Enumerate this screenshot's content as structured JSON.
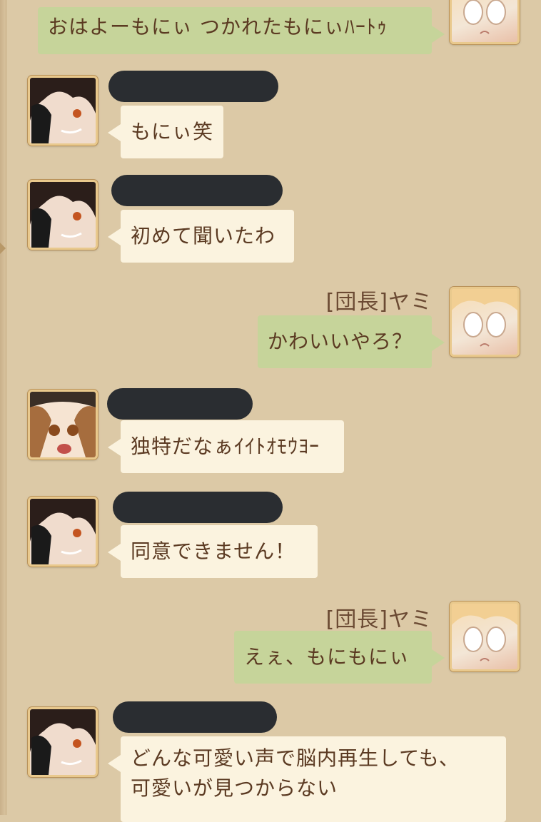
{
  "messages": [
    {
      "side": "right",
      "sender": "",
      "text": "おはよーもにぃ つかれたもにぃﾊｰﾄｩ"
    },
    {
      "side": "left",
      "sender_redacted": true,
      "text": "もにぃ笑"
    },
    {
      "side": "left",
      "sender_redacted": true,
      "text": "初めて聞いたわ"
    },
    {
      "side": "right",
      "sender": "[団長]ヤミ",
      "text": "かわいいやろ？"
    },
    {
      "side": "left",
      "sender_redacted": true,
      "text": "独特だなぁｲｲﾄｵﾓｳﾖｰ"
    },
    {
      "side": "left",
      "sender_redacted": true,
      "text": "同意できません！"
    },
    {
      "side": "right",
      "sender": "[団長]ヤミ",
      "text": "えぇ、もにもにぃ"
    },
    {
      "side": "left",
      "sender_redacted": true,
      "text": "どんな可愛い声で脳内再生しても、\n可愛いが見つからない",
      "lines": [
        "どんな可愛い声で脳内再生しても、",
        "可愛いが見つからない"
      ]
    }
  ],
  "colors": {
    "background": "#dcc9a6",
    "bubble_left": "#fbf3df",
    "bubble_right": "#c6d49a",
    "text": "#5b3a22",
    "redaction": "#2a2d31"
  }
}
